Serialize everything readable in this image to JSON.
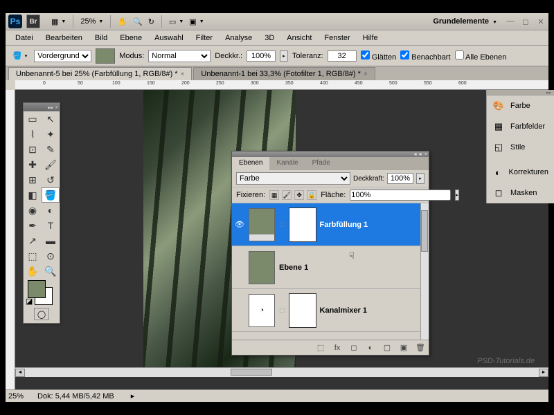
{
  "titlebar": {
    "zoom_dropdown": "25%",
    "workspace": "Grundelemente"
  },
  "menu": {
    "file": "Datei",
    "edit": "Bearbeiten",
    "image": "Bild",
    "layer": "Ebene",
    "select": "Auswahl",
    "filter": "Filter",
    "analysis": "Analyse",
    "view_3d": "3D",
    "view": "Ansicht",
    "window": "Fenster",
    "help": "Hilfe"
  },
  "optbar": {
    "fill_select": "Vordergrund",
    "mode_label": "Modus:",
    "mode_value": "Normal",
    "opacity_label": "Deckkr.:",
    "opacity_value": "100%",
    "tolerance_label": "Toleranz:",
    "tolerance_value": "32",
    "antialias": "Glätten",
    "contiguous": "Benachbart",
    "all_layers": "Alle Ebenen"
  },
  "tabs": {
    "tab1": "Unbenannt-5 bei 25% (Farbfüllung 1, RGB/8#) *",
    "tab2": "Unbenannt-1 bei 33,3% (Fotofilter 1, RGB/8#) *"
  },
  "layers_panel": {
    "tab_layers": "Ebenen",
    "tab_channels": "Kanäle",
    "tab_paths": "Pfade",
    "blend_mode": "Farbe",
    "opacity_label": "Deckkraft:",
    "opacity_value": "100%",
    "lock_label": "Fixieren:",
    "fill_label": "Fläche:",
    "fill_value": "100%",
    "layer1": "Farbfüllung 1",
    "layer2": "Ebene 1",
    "layer3": "Kanalmixer 1"
  },
  "right_panel": {
    "color": "Farbe",
    "swatches": "Farbfelder",
    "styles": "Stile",
    "adjustments": "Korrekturen",
    "masks": "Masken"
  },
  "statusbar": {
    "zoom": "25%",
    "doc": "Dok: 5,44 MB/5,42 MB"
  },
  "watermark": "PSD-Tutorials.de"
}
